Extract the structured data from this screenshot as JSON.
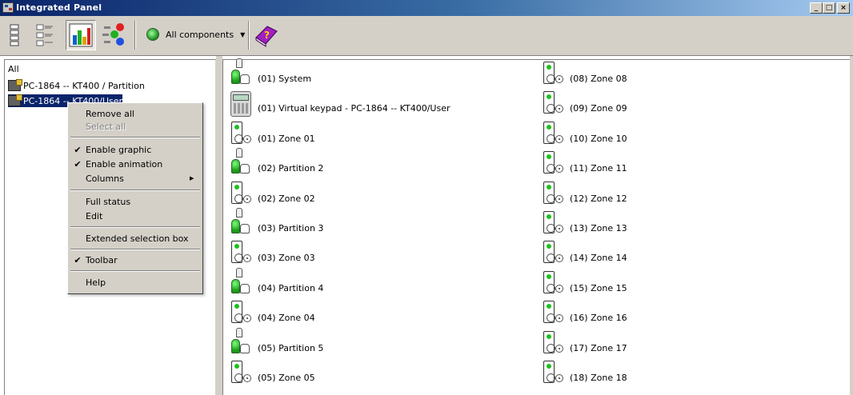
{
  "window": {
    "title": "Integrated Panel",
    "buttons": {
      "minimize": "_",
      "maximize": "□",
      "close": "×"
    }
  },
  "toolbar": {
    "filter_label": "All components",
    "filter_arrow": "▼",
    "icons": [
      "panel-list-icon",
      "details-list-icon",
      "graphic-view-icon",
      "animation-icon",
      "status-led-icon",
      "help-book-icon"
    ]
  },
  "tree": {
    "items": [
      {
        "label": "All",
        "icon": ""
      },
      {
        "label": "PC-1864 -- KT400 / Partition",
        "icon": "panel-icon"
      },
      {
        "label": "PC-1864 -- KT400/User",
        "icon": "panel-icon"
      }
    ]
  },
  "context_menu": {
    "items": [
      {
        "label": "Remove all",
        "checked": false,
        "disabled": false
      },
      {
        "label": "Select all",
        "checked": false,
        "disabled": true
      },
      {
        "label": "Enable graphic",
        "checked": true,
        "disabled": false
      },
      {
        "label": "Enable animation",
        "checked": true,
        "disabled": false
      },
      {
        "label": "Columns",
        "checked": false,
        "disabled": false,
        "submenu": true
      },
      {
        "label": "Full status",
        "checked": false,
        "disabled": false
      },
      {
        "label": "Edit",
        "checked": false,
        "disabled": false
      },
      {
        "label": "Extended selection box",
        "checked": false,
        "disabled": false
      },
      {
        "label": "Toolbar",
        "checked": true,
        "disabled": false
      },
      {
        "label": "Help",
        "checked": false,
        "disabled": false
      }
    ],
    "check_mark": "✔",
    "submenu_arrow": "▶"
  },
  "components": {
    "left_column": [
      {
        "type": "partition",
        "label": "(01) System"
      },
      {
        "type": "keypad",
        "label": "(01) Virtual keypad - PC-1864 -- KT400/User"
      },
      {
        "type": "zone",
        "label": "(01) Zone   01"
      },
      {
        "type": "partition",
        "label": "(02) Partition 2"
      },
      {
        "type": "zone",
        "label": "(02) Zone   02"
      },
      {
        "type": "partition",
        "label": "(03) Partition 3"
      },
      {
        "type": "zone",
        "label": "(03) Zone   03"
      },
      {
        "type": "partition",
        "label": "(04) Partition 4"
      },
      {
        "type": "zone",
        "label": "(04) Zone   04"
      },
      {
        "type": "partition",
        "label": "(05) Partition 5"
      },
      {
        "type": "zone",
        "label": "(05) Zone   05"
      }
    ],
    "right_column": [
      {
        "type": "zone",
        "label": "(08) Zone   08"
      },
      {
        "type": "zone",
        "label": "(09) Zone   09"
      },
      {
        "type": "zone",
        "label": "(10) Zone   10"
      },
      {
        "type": "zone",
        "label": "(11) Zone   11"
      },
      {
        "type": "zone",
        "label": "(12) Zone   12"
      },
      {
        "type": "zone",
        "label": "(13) Zone   13"
      },
      {
        "type": "zone",
        "label": "(14) Zone   14"
      },
      {
        "type": "zone",
        "label": "(15) Zone   15"
      },
      {
        "type": "zone",
        "label": "(16) Zone   16"
      },
      {
        "type": "zone",
        "label": "(17) Zone   17"
      },
      {
        "type": "zone",
        "label": "(18) Zone   18"
      }
    ]
  },
  "colors": {
    "title_gradient_start": "#0a246a",
    "title_gradient_end": "#a6caf0",
    "selection": "#0a246a",
    "zone_led": "#1fbf1f",
    "chrome": "#d4d0c8"
  }
}
